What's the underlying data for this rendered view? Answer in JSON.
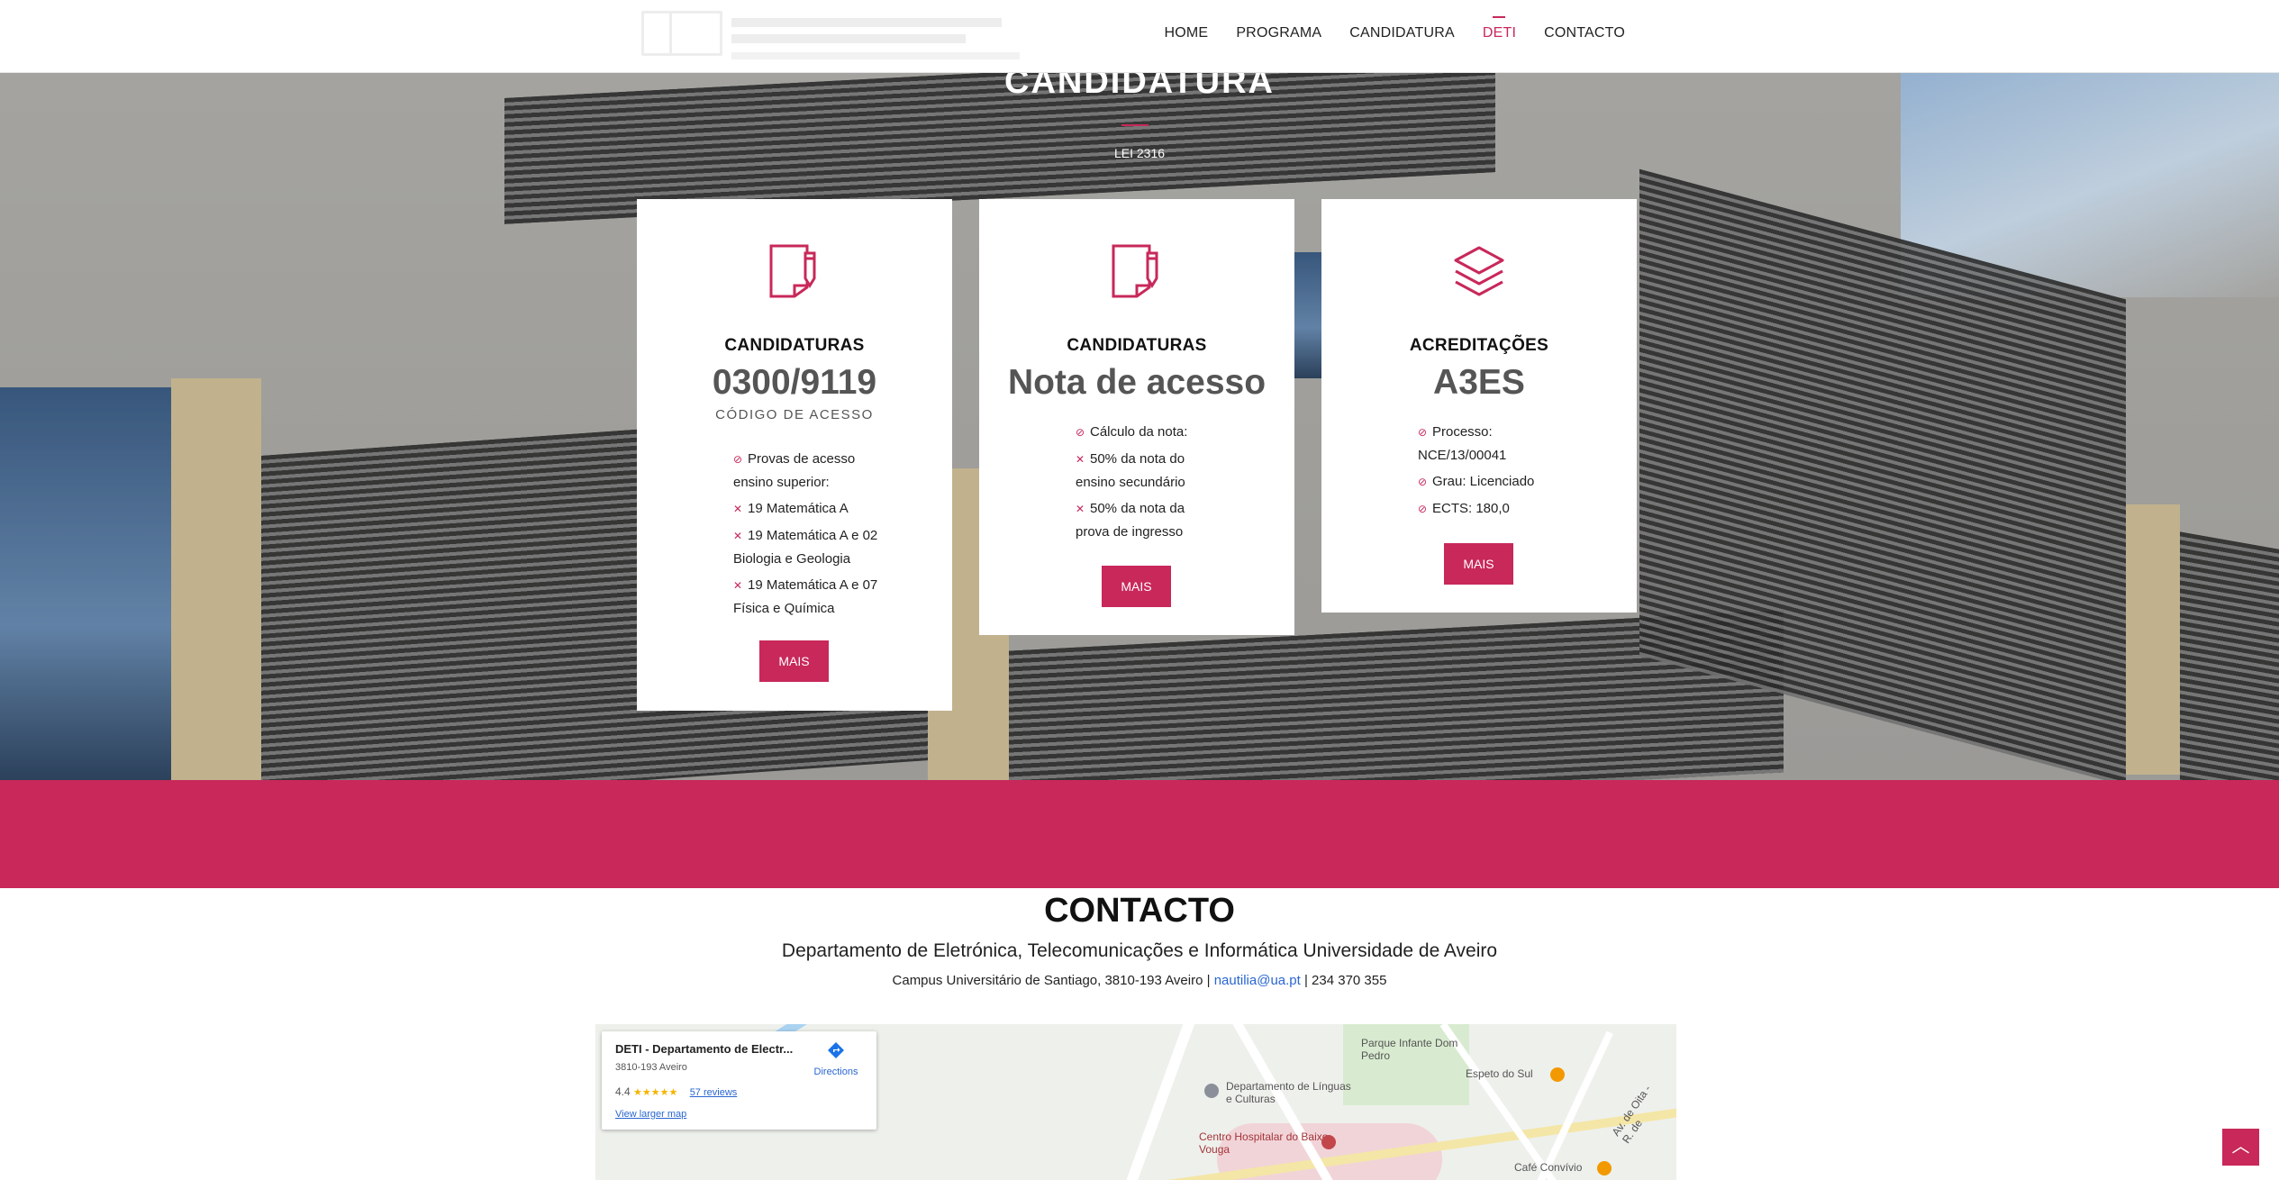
{
  "nav": {
    "items": [
      "HOME",
      "PROGRAMA",
      "CANDIDATURA",
      "DETI",
      "CONTACTO"
    ],
    "active_index": 3
  },
  "hero": {
    "title": "CANDIDATURA",
    "subtitle": "LEI 2316"
  },
  "cards": [
    {
      "icon": "document-pencil-icon",
      "heading": "CANDIDATURAS",
      "big": "0300/9119",
      "code_label": "CÓDIGO DE ACESSO",
      "items": [
        {
          "type": "check",
          "text": "Provas de acesso ensino superior:"
        },
        {
          "type": "cross",
          "text": "19 Matemática A"
        },
        {
          "type": "cross",
          "text": "19 Matemática A e 02 Biologia e Geologia"
        },
        {
          "type": "cross",
          "text": "19 Matemática A e 07 Física e Química"
        }
      ],
      "button": "MAIS"
    },
    {
      "icon": "document-pencil-icon",
      "heading": "CANDIDATURAS",
      "big": "Nota de acesso",
      "items": [
        {
          "type": "check",
          "text": "Cálculo da nota:"
        },
        {
          "type": "cross",
          "text": "50% da nota do ensino secundário"
        },
        {
          "type": "cross",
          "text": "50% da nota da prova de ingresso"
        }
      ],
      "button": "MAIS"
    },
    {
      "icon": "layers-icon",
      "heading": "ACREDITAÇÕES",
      "big": "A3ES",
      "items": [
        {
          "type": "check",
          "text": "Processo: NCE/13/00041"
        },
        {
          "type": "check",
          "text": "Grau: Licenciado"
        },
        {
          "type": "check",
          "text": "ECTS: 180,0"
        }
      ],
      "button": "MAIS"
    }
  ],
  "contact": {
    "title": "CONTACTO",
    "department": "Departamento de Eletrónica, Telecomunicações e Informática Universidade de Aveiro",
    "address": "Campus Universitário de Santiago, 3810-193 Aveiro |",
    "email": "nautilia@ua.pt",
    "phone": "| 234 370 355"
  },
  "map": {
    "place_name": "DETI - Departamento de Electr...",
    "place_address": "3810-193 Aveiro",
    "rating": "4.4",
    "stars": "★★★★★",
    "reviews": "57 reviews",
    "directions": "Directions",
    "view_larger": "View larger map",
    "labels": {
      "park": "Parque Infante Dom Pedro",
      "dept_linguas": "Departamento de Línguas e Culturas",
      "hospital": "Centro Hospitalar do Baixo Vouga",
      "espeto": "Espeto do Sul",
      "cafe": "Café Convívio",
      "street": "Av. de Oita - R. de"
    }
  },
  "colors": {
    "accent": "#c8285a",
    "link": "#2a66d1"
  }
}
